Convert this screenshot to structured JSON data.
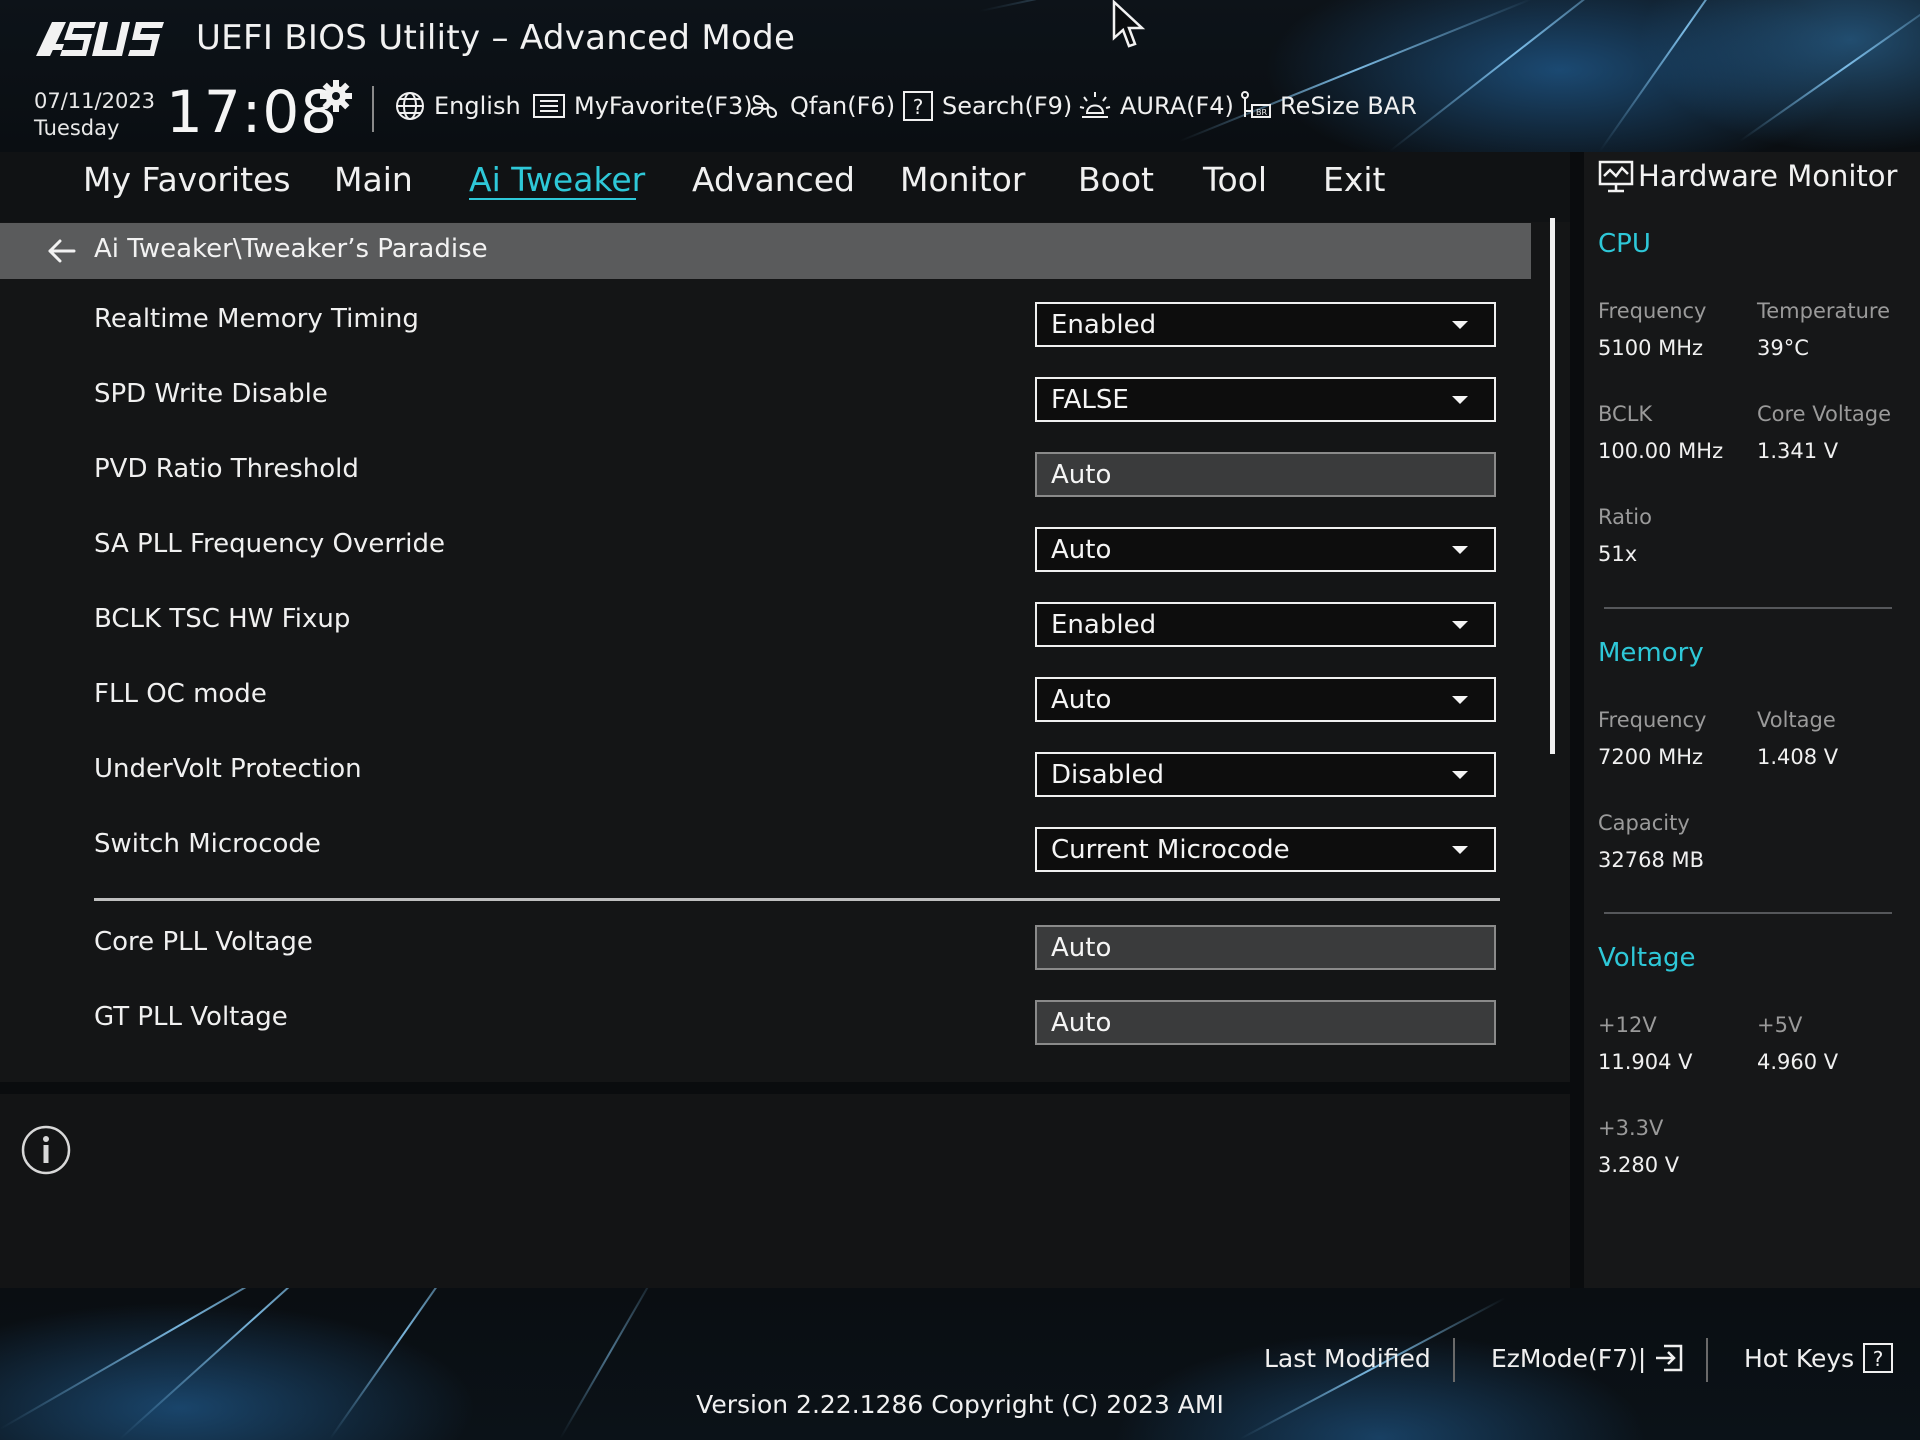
{
  "header": {
    "brand": "ASUS",
    "title": "UEFI BIOS Utility – Advanced Mode",
    "date": "07/11/2023",
    "day": "Tuesday",
    "time": "17:08",
    "toolbar": [
      {
        "label": "English",
        "icon": "globe-icon"
      },
      {
        "label": "MyFavorite(F3)",
        "icon": "favorite-list-icon"
      },
      {
        "label": "Qfan(F6)",
        "icon": "fan-icon"
      },
      {
        "label": "Search(F9)",
        "icon": "search-help-icon"
      },
      {
        "label": "AURA(F4)",
        "icon": "aura-light-icon"
      },
      {
        "label": "ReSize BAR",
        "icon": "resize-bar-icon"
      }
    ]
  },
  "nav": {
    "tabs": [
      {
        "label": "My Favorites"
      },
      {
        "label": "Main"
      },
      {
        "label": "Ai Tweaker"
      },
      {
        "label": "Advanced"
      },
      {
        "label": "Monitor"
      },
      {
        "label": "Boot"
      },
      {
        "label": "Tool"
      },
      {
        "label": "Exit"
      }
    ],
    "active": "Ai Tweaker"
  },
  "main": {
    "breadcrumb": "Ai Tweaker\\Tweaker’s Paradise",
    "settings": [
      {
        "label": "Realtime Memory Timing",
        "value": "Enabled",
        "type": "dropdown"
      },
      {
        "label": "SPD Write Disable",
        "value": "FALSE",
        "type": "dropdown"
      },
      {
        "label": "PVD Ratio Threshold",
        "value": "Auto",
        "type": "field"
      },
      {
        "label": "SA PLL Frequency Override",
        "value": "Auto",
        "type": "dropdown"
      },
      {
        "label": "BCLK TSC HW Fixup",
        "value": "Enabled",
        "type": "dropdown"
      },
      {
        "label": "FLL OC mode",
        "value": "Auto",
        "type": "dropdown"
      },
      {
        "label": "UnderVolt Protection",
        "value": "Disabled",
        "type": "dropdown"
      },
      {
        "label": "Switch Microcode",
        "value": "Current Microcode",
        "type": "dropdown"
      },
      {
        "label": "Core PLL Voltage",
        "value": "Auto",
        "type": "field"
      },
      {
        "label": "GT PLL Voltage",
        "value": "Auto",
        "type": "field"
      }
    ]
  },
  "hardware_monitor": {
    "title": "Hardware Monitor",
    "cpu": {
      "heading": "CPU",
      "frequency_label": "Frequency",
      "frequency": "5100 MHz",
      "temperature_label": "Temperature",
      "temperature": "39°C",
      "bclk_label": "BCLK",
      "bclk": "100.00 MHz",
      "core_voltage_label": "Core Voltage",
      "core_voltage": "1.341 V",
      "ratio_label": "Ratio",
      "ratio": "51x"
    },
    "memory": {
      "heading": "Memory",
      "frequency_label": "Frequency",
      "frequency": "7200 MHz",
      "voltage_label": "Voltage",
      "voltage": "1.408 V",
      "capacity_label": "Capacity",
      "capacity": "32768 MB"
    },
    "voltage": {
      "heading": "Voltage",
      "v12_label": "+12V",
      "v12": "11.904 V",
      "v5_label": "+5V",
      "v5": "4.960 V",
      "v33_label": "+3.3V",
      "v33": "3.280 V"
    }
  },
  "footer": {
    "last_modified": "Last Modified",
    "ezmode": "EzMode(F7)|",
    "hot_keys": "Hot Keys",
    "version": "Version 2.22.1286 Copyright (C) 2023 AMI"
  },
  "colors": {
    "accent": "#2ec8d8",
    "background": "#141516",
    "breadcrumb_bar": "#5a5b5c"
  }
}
